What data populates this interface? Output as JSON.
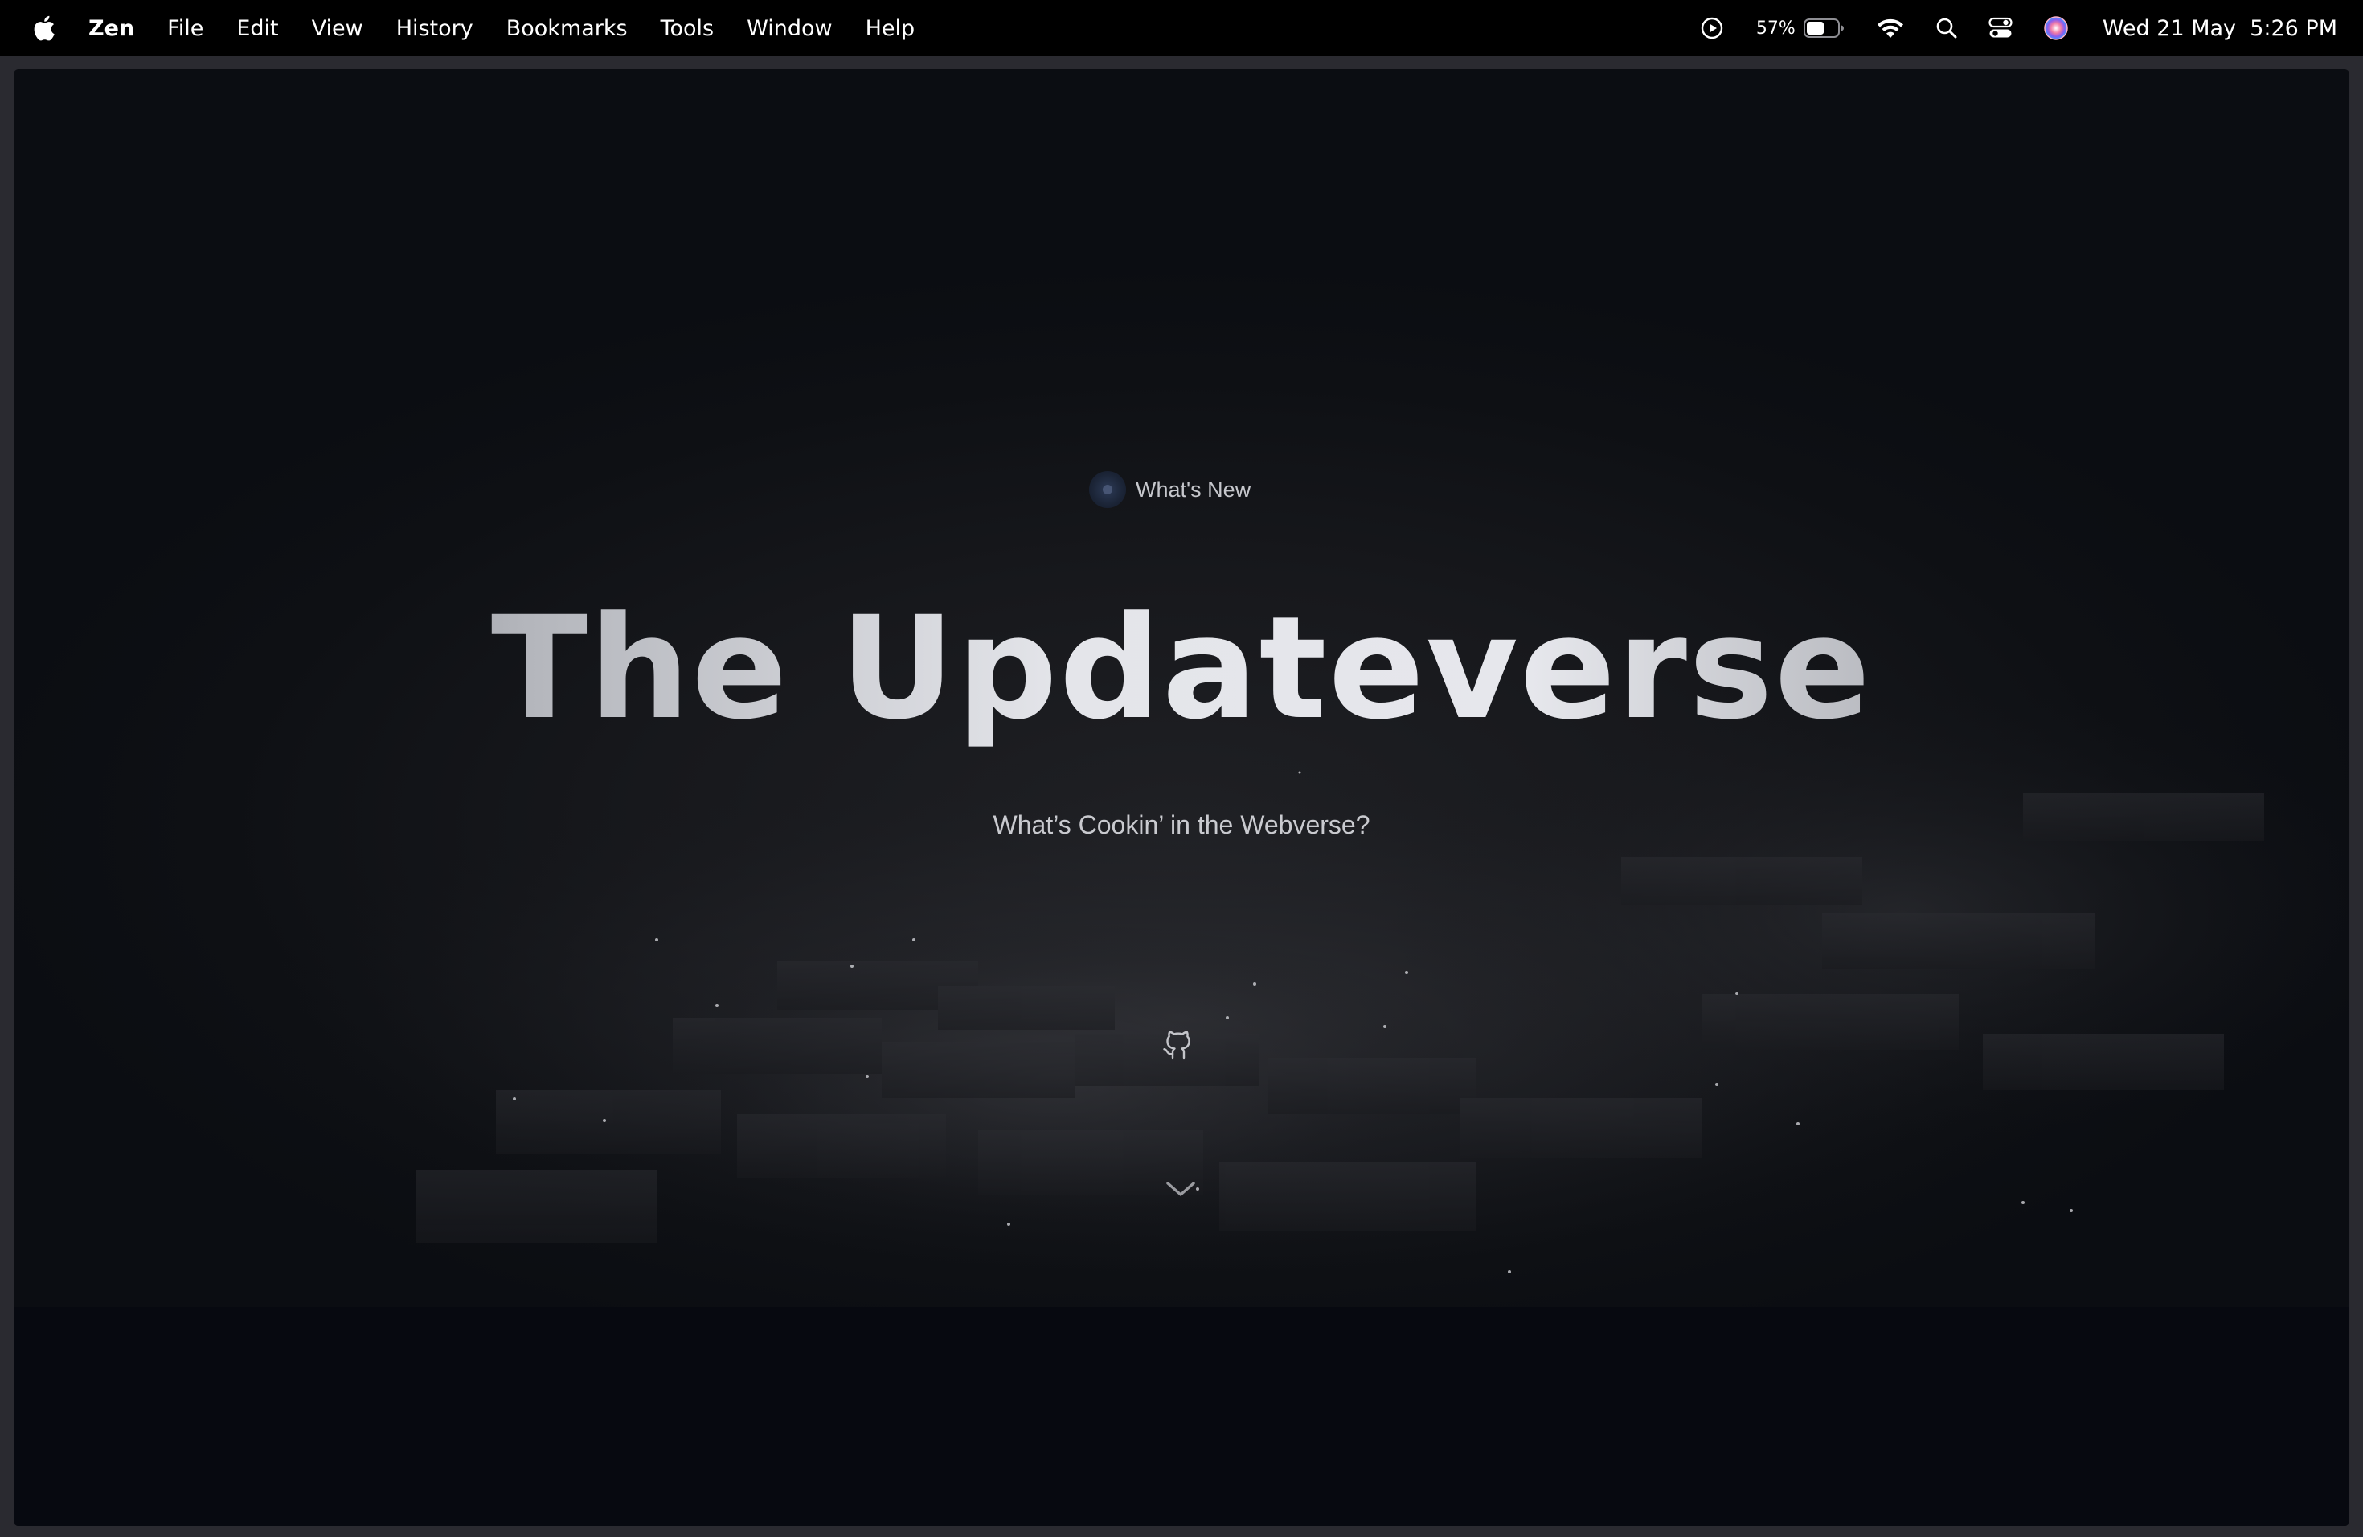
{
  "menubar": {
    "apple_icon": "apple-logo-icon",
    "items": [
      {
        "label": "Zen",
        "name": "menu-zen"
      },
      {
        "label": "File",
        "name": "menu-file"
      },
      {
        "label": "Edit",
        "name": "menu-edit"
      },
      {
        "label": "View",
        "name": "menu-view"
      },
      {
        "label": "History",
        "name": "menu-history"
      },
      {
        "label": "Bookmarks",
        "name": "menu-bookmarks"
      },
      {
        "label": "Tools",
        "name": "menu-tools"
      },
      {
        "label": "Window",
        "name": "menu-window"
      },
      {
        "label": "Help",
        "name": "menu-help"
      }
    ],
    "status": {
      "battery_percent": "57%",
      "battery_level": 0.57,
      "date": "Wed 21 May",
      "time": "5:26 PM"
    }
  },
  "page": {
    "badge_label": "What's New",
    "title": "The Updateverse",
    "subtitle": "What’s Cookin’ in the Webverse?",
    "github_icon": "github-octocat-icon",
    "scroll_icon": "chevron-down-icon"
  },
  "colors": {
    "menubar_bg": "#000000",
    "page_bg": "#0b0d12",
    "title_light": "#e4e5ea",
    "title_dark": "#6d6e74",
    "subtitle": "#c9cacf",
    "badge_dot": "#1b2436"
  }
}
